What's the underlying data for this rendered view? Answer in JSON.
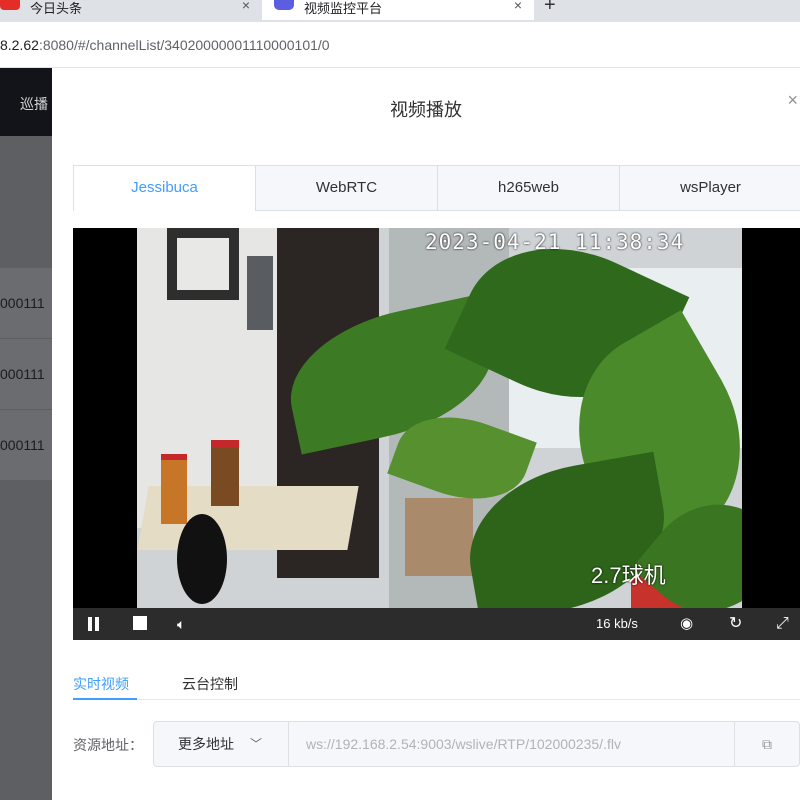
{
  "browser": {
    "tabs": [
      {
        "title": "今日头条",
        "icon_name": "toutiao-icon",
        "close": "×"
      },
      {
        "title": "视频监控平台",
        "icon_name": "app-logo-icon",
        "close": "×"
      }
    ],
    "new_tab": "+",
    "url_host": "8.2.62",
    "url_rest": ":8080/#/channelList/34020000001110000101/0"
  },
  "background": {
    "nav_label": "巡播",
    "row_ids": [
      "000111",
      "000111",
      "000111"
    ]
  },
  "dialog": {
    "title": "视频播放",
    "close": "×",
    "player_tabs": [
      "Jessibuca",
      "WebRTC",
      "h265web",
      "wsPlayer"
    ],
    "active_player_tab": 0,
    "video": {
      "timestamp": "2023-04-21  11:38:34",
      "camera_label": "2.7球机",
      "bitrate": "16 kb/s"
    },
    "sub_tabs": [
      "实时视频",
      "云台控制"
    ],
    "active_sub_tab": 0,
    "source_label": "资源地址：",
    "more_addresses": "更多地址",
    "source_url": "ws://192.168.2.54:9003/wslive/RTP/102000235/.flv"
  },
  "colors": {
    "accent": "#409eff",
    "overlay": "#5d5f63",
    "control_bar": "#2c2c2c"
  }
}
